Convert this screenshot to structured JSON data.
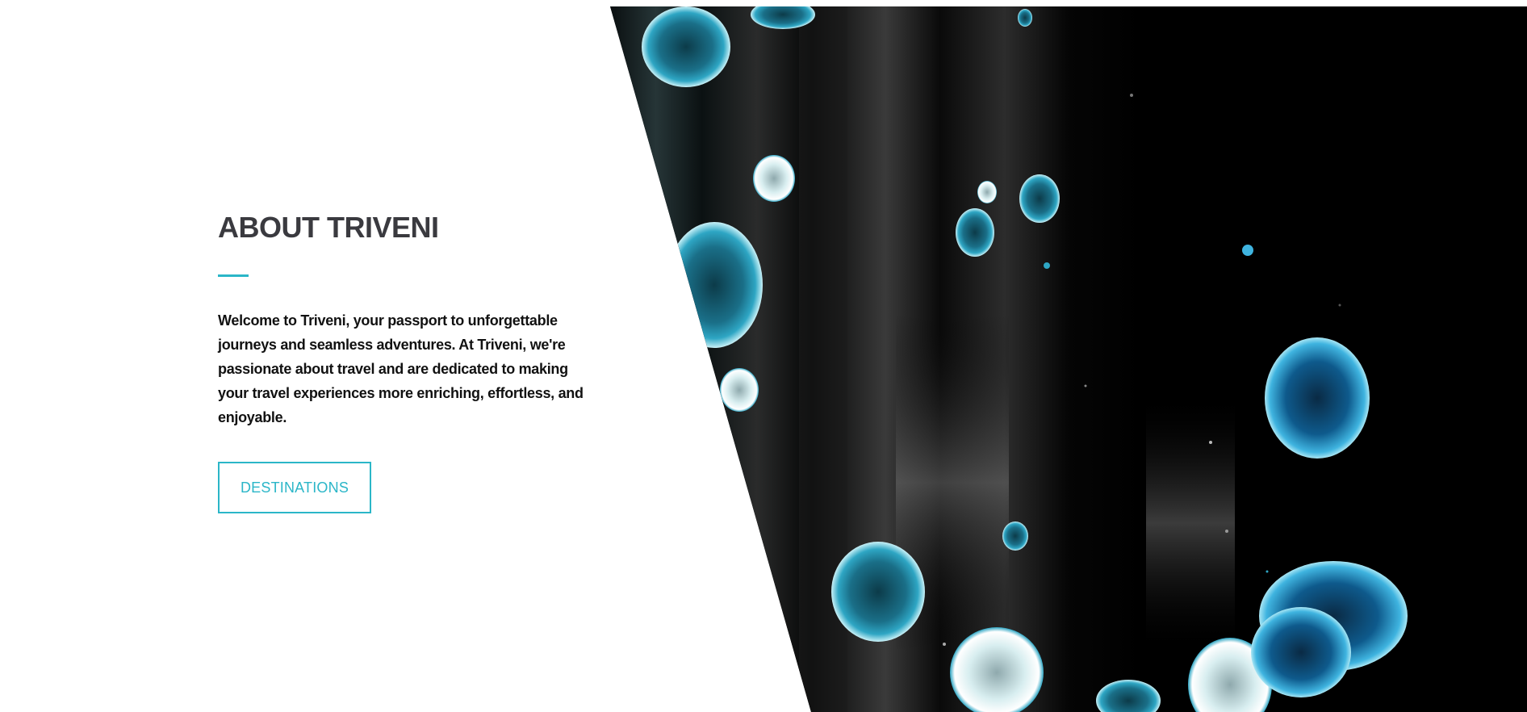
{
  "colors": {
    "accent": "#2bb6c8",
    "heading": "#3a3a3f",
    "body_text": "#111111",
    "image_background": "#000000"
  },
  "about": {
    "title": "ABOUT TRIVENI",
    "description": "Welcome to Triveni, your passport to unforgettable journeys and seamless adventures. At Triveni, we're passionate about travel and are dedicated to making your travel experiences more enriching, effortless, and enjoyable.",
    "button_label": "DESTINATIONS"
  },
  "hero_image": {
    "subject": "abstract black fluid art with teal and white cells"
  }
}
